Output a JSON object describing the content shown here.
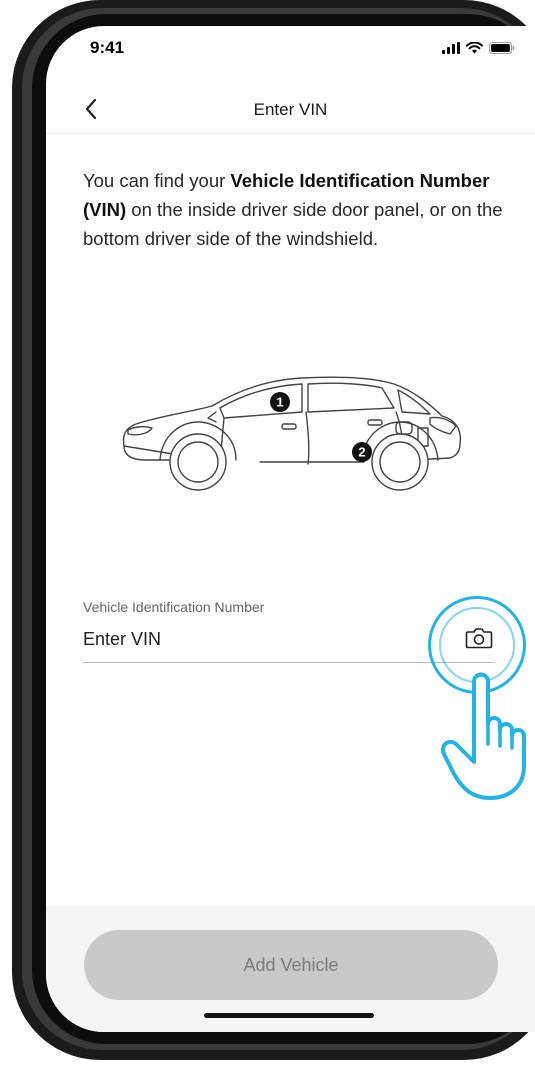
{
  "status_bar": {
    "time": "9:41",
    "icons": [
      "signal-icon",
      "wifi-icon",
      "battery-icon"
    ]
  },
  "nav": {
    "title": "Enter VIN",
    "back_icon": "chevron-left-icon"
  },
  "instructions": {
    "prefix": "You can find your ",
    "bold": "Vehicle Identification Number (VIN)",
    "suffix": " on the inside driver side door panel, or on the bottom driver side of the windshield."
  },
  "illustration": {
    "markers": [
      "1",
      "2"
    ]
  },
  "vin_field": {
    "label": "Vehicle Identification Number",
    "placeholder": "Enter VIN",
    "value": "",
    "camera_icon": "camera-icon"
  },
  "footer": {
    "button_label": "Add Vehicle"
  },
  "colors": {
    "accent": "#21b4e4",
    "button_disabled_bg": "#c9c9c9",
    "button_disabled_text": "#7a7a7a"
  }
}
